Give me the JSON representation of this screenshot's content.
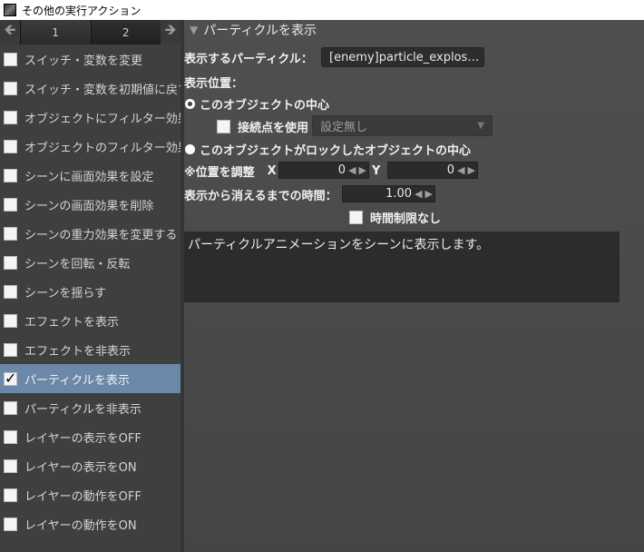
{
  "window": {
    "title": "その他の実行アクション"
  },
  "sidebar": {
    "pager": {
      "prev_icon": "arrow-left",
      "next_icon": "arrow-right",
      "pages": [
        "1",
        "2"
      ]
    },
    "items": [
      {
        "label": "スイッチ・変数を変更",
        "checked": false
      },
      {
        "label": "スイッチ・変数を初期値に戻す",
        "checked": false
      },
      {
        "label": "オブジェクトにフィルター効果",
        "checked": false
      },
      {
        "label": "オブジェクトのフィルター効果",
        "checked": false
      },
      {
        "label": "シーンに画面効果を設定",
        "checked": false
      },
      {
        "label": "シーンの画面効果を削除",
        "checked": false
      },
      {
        "label": "シーンの重力効果を変更する",
        "checked": false
      },
      {
        "label": "シーンを回転・反転",
        "checked": false
      },
      {
        "label": "シーンを揺らす",
        "checked": false
      },
      {
        "label": "エフェクトを表示",
        "checked": false
      },
      {
        "label": "エフェクトを非表示",
        "checked": false
      },
      {
        "label": "パーティクルを表示",
        "checked": true
      },
      {
        "label": "パーティクルを非表示",
        "checked": false
      },
      {
        "label": "レイヤーの表示をOFF",
        "checked": false
      },
      {
        "label": "レイヤーの表示をON",
        "checked": false
      },
      {
        "label": "レイヤーの動作をOFF",
        "checked": false
      },
      {
        "label": "レイヤーの動作をON",
        "checked": false
      }
    ]
  },
  "main": {
    "section_title": "パーティクルを表示",
    "particle_label": "表示するパーティクル：",
    "particle_value": "[enemy]particle_explos…",
    "position_label": "表示位置：",
    "radio_center": "このオブジェクトの中心",
    "connection_label": "接続点を使用",
    "connection_select": "設定無し",
    "radio_locked": "このオブジェクトがロックしたオブジェクトの中心",
    "adjust_label": "※位置を調整",
    "x_label": "X",
    "x_value": "0",
    "y_label": "Y",
    "y_value": "0",
    "duration_label": "表示から消えるまでの時間：",
    "duration_value": "1.00",
    "no_limit_label": "時間制限なし",
    "description": "パーティクルアニメーションをシーンに表示します。"
  }
}
